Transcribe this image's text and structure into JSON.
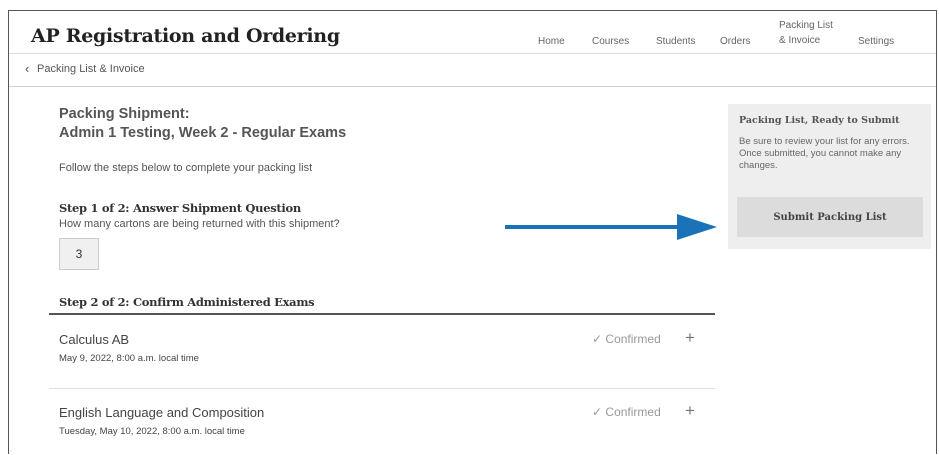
{
  "app": {
    "title": "AP Registration and Ordering"
  },
  "nav": {
    "home": "Home",
    "courses": "Courses",
    "students": "Students",
    "orders": "Orders",
    "packing_line1": "Packing List",
    "packing_line2": "& Invoice",
    "settings": "Settings"
  },
  "breadcrumb": {
    "label": "Packing List & Invoice"
  },
  "main": {
    "title_line1": "Packing Shipment:",
    "title_line2": "Admin 1 Testing, Week 2 - Regular Exams",
    "intro": "Follow the steps below to complete your packing list",
    "step1": {
      "heading": "Step 1 of 2: Answer Shipment Question",
      "question": "How many cartons are being returned with this shipment?",
      "cartons_value": "3"
    },
    "step2": {
      "heading": "Step 2 of 2: Confirm Administered Exams"
    },
    "exams": [
      {
        "name": "Calculus AB",
        "date": "May 9, 2022, 8:00 a.m. local time",
        "status": "Confirmed"
      },
      {
        "name": "English Language and Composition",
        "date": "Tuesday, May 10, 2022, 8:00 a.m. local time",
        "status": "Confirmed"
      }
    ]
  },
  "sidebar": {
    "title": "Packing List, Ready to Submit",
    "body": "Be sure to review your list for any errors. Once submitted, you cannot make any changes.",
    "submit_label": "Submit Packing List"
  },
  "icons": {
    "back": "chevron-left-icon",
    "check": "checkmark-icon",
    "expand": "plus-icon",
    "arrow": "arrow-right-icon"
  },
  "colors": {
    "arrow": "#1a73b8",
    "rule": "#555555",
    "panel": "#eeeeee"
  }
}
